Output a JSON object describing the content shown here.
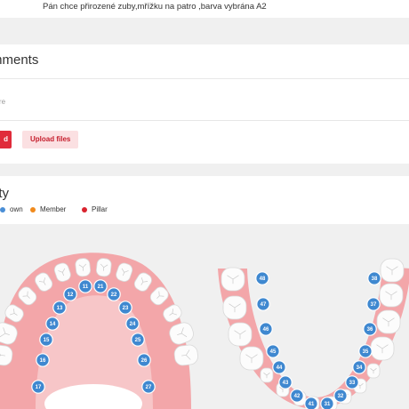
{
  "order_note": "Pán chce přirozené zuby,mřížku na patro ,barva vybrána A2",
  "comments": {
    "title": "mments",
    "placeholder": "here",
    "submit_label": "d",
    "upload_label": "Upload files"
  },
  "treatment": {
    "title": "rity",
    "legend": [
      {
        "label": "own",
        "color": "#4a8ed6"
      },
      {
        "label": "Member",
        "color": "#f08a1c"
      },
      {
        "label": "Pillar",
        "color": "#d9232e"
      }
    ]
  },
  "teeth_chart": {
    "badge_color": "#3f88d0",
    "gum_color": "#f3a6a9",
    "upper_arch_badges": [
      "11",
      "21",
      "12",
      "22",
      "13",
      "23",
      "14",
      "24",
      "15",
      "25",
      "16",
      "26",
      "17",
      "27"
    ],
    "lower_arch_left_badges": [
      "48",
      "47",
      "46",
      "45",
      "44",
      "43",
      "42",
      "41"
    ],
    "lower_arch_right_badges": [
      "31",
      "32",
      "33",
      "34",
      "35",
      "36",
      "37",
      "38"
    ]
  }
}
